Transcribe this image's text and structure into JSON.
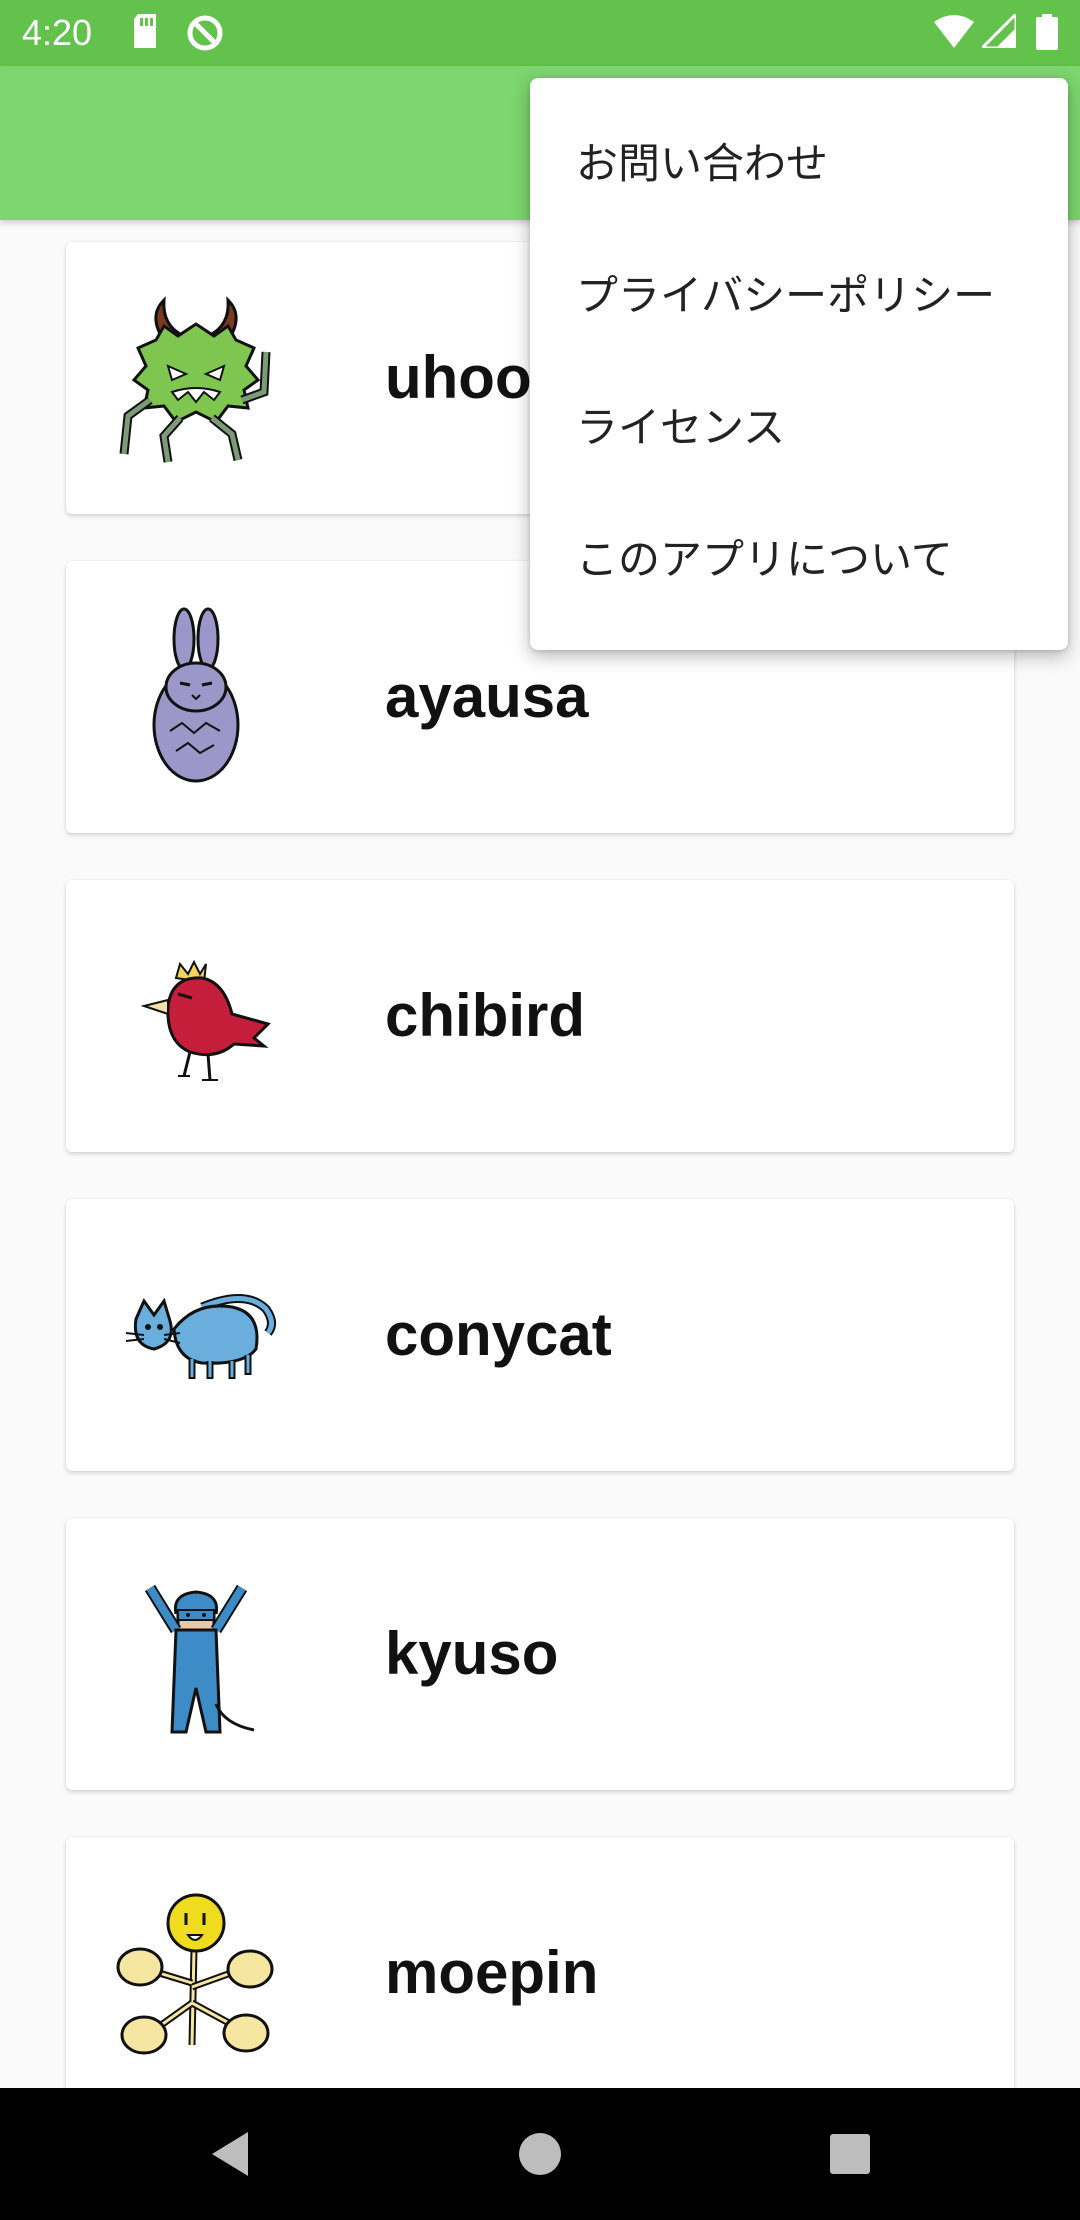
{
  "status_bar": {
    "time": "4:20",
    "icons": [
      "sd-card-icon",
      "sync-icon",
      "wifi-icon",
      "signal-icon",
      "battery-icon"
    ],
    "background": "#62c24b"
  },
  "app_bar": {
    "background": "#7dd66f"
  },
  "list": {
    "items": [
      {
        "label": "uhoo",
        "icon": "green-monster-icon"
      },
      {
        "label": "ayausa",
        "icon": "purple-rabbit-icon"
      },
      {
        "label": "chibird",
        "icon": "red-bird-icon"
      },
      {
        "label": "conycat",
        "icon": "blue-cat-icon"
      },
      {
        "label": "kyuso",
        "icon": "blue-mouse-icon"
      },
      {
        "label": "moepin",
        "icon": "yellow-flower-icon"
      }
    ]
  },
  "overflow_menu": {
    "items": [
      {
        "label": "お問い合わせ"
      },
      {
        "label": "プライバシーポリシー"
      },
      {
        "label": "ライセンス"
      },
      {
        "label": "このアプリについて"
      }
    ]
  },
  "nav_bar": {
    "buttons": [
      "back-icon",
      "home-icon",
      "recents-icon"
    ]
  }
}
